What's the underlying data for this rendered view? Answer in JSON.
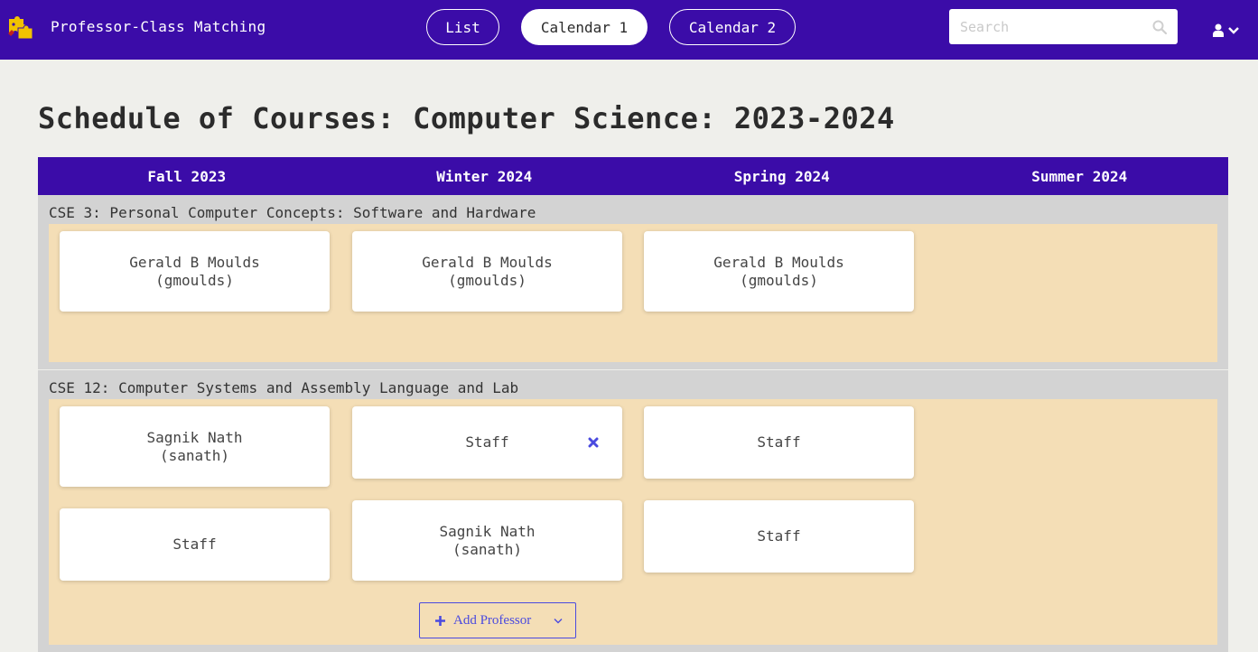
{
  "header": {
    "app_title": "Professor-Class Matching",
    "nav": [
      {
        "label": "List",
        "active": false
      },
      {
        "label": "Calendar 1",
        "active": true
      },
      {
        "label": "Calendar 2",
        "active": false
      }
    ],
    "search_placeholder": "Search",
    "icons": {
      "logo": "puzzle-logo-icon",
      "search": "search-icon",
      "user": "user-icon",
      "dropdown": "chevron-down-icon"
    },
    "colors": {
      "primary": "#3b0ca8",
      "background": "#efefeb",
      "course_area": "#f4deb6",
      "course_block": "#d3d3d3",
      "accent": "#4a4adf"
    }
  },
  "page": {
    "title": "Schedule of Courses: Computer Science: 2023-2024",
    "terms": [
      "Fall 2023",
      "Winter 2024",
      "Spring 2024",
      "Summer 2024"
    ]
  },
  "courses": [
    {
      "title": "CSE 3: Personal Computer Concepts: Software and Hardware",
      "assignments": [
        {
          "term": "Fall 2023",
          "name": "Gerald B Moulds",
          "username": "(gmoulds)"
        },
        {
          "term": "Winter 2024",
          "name": "Gerald B Moulds",
          "username": "(gmoulds)"
        },
        {
          "term": "Spring 2024",
          "name": "Gerald B Moulds",
          "username": "(gmoulds)"
        }
      ]
    },
    {
      "title": "CSE 12: Computer Systems and Assembly Language and Lab",
      "assignments": [
        {
          "term": "Fall 2023",
          "name": "Sagnik Nath",
          "username": "(sanath)"
        },
        {
          "term": "Winter 2024",
          "name": "Staff",
          "remove_icon": "close-icon"
        },
        {
          "term": "Spring 2024",
          "name": "Staff"
        },
        {
          "term": "Fall 2023",
          "name": "Staff"
        },
        {
          "term": "Winter 2024",
          "name": "Sagnik Nath",
          "username": "(sanath)"
        },
        {
          "term": "Spring 2024",
          "name": "Staff"
        }
      ],
      "add_button_label": "Add Professor"
    }
  ]
}
